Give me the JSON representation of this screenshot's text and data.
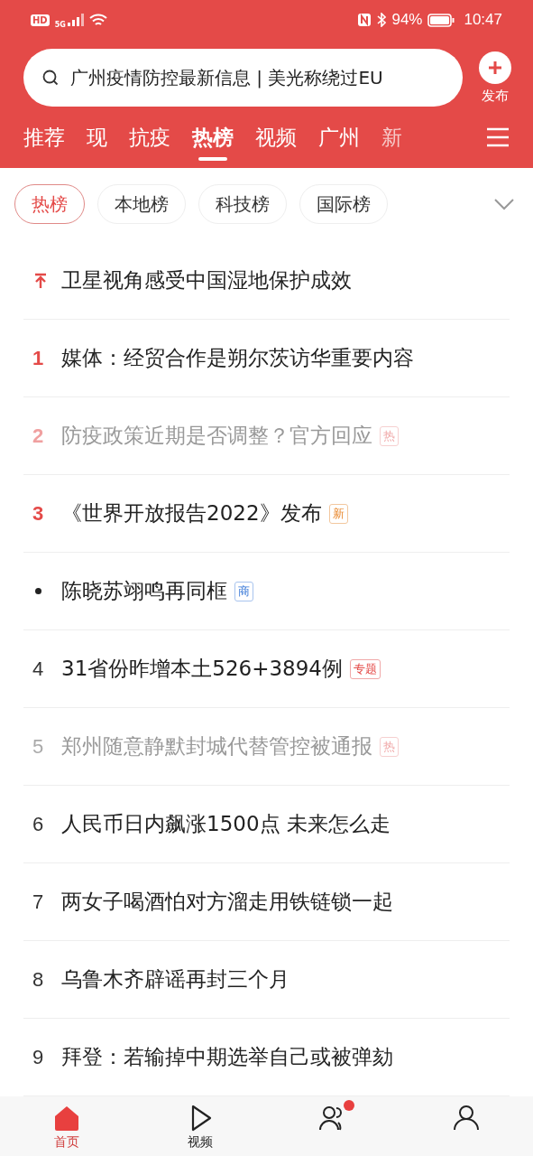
{
  "status_bar": {
    "hd": "HD",
    "network": "5G",
    "battery": "94%",
    "time": "10:47"
  },
  "search": {
    "value": "广州疫情防控最新信息 | 美光称绕过EU"
  },
  "publish": {
    "label": "发布"
  },
  "tabs": [
    {
      "label": "推荐",
      "selected": false
    },
    {
      "label": "现",
      "selected": false
    },
    {
      "label": "抗疫",
      "selected": false
    },
    {
      "label": "热榜",
      "selected": true
    },
    {
      "label": "视频",
      "selected": false
    },
    {
      "label": "广州",
      "selected": false
    },
    {
      "label": "新",
      "selected": false
    }
  ],
  "chips": [
    {
      "label": "热榜",
      "selected": true
    },
    {
      "label": "本地榜",
      "selected": false
    },
    {
      "label": "科技榜",
      "selected": false
    },
    {
      "label": "国际榜",
      "selected": false
    }
  ],
  "rows": [
    {
      "kind": "pinned",
      "title": "卫星视角感受中国湿地保护成效",
      "read": false
    },
    {
      "kind": "top",
      "rank": "1",
      "title": "媒体：经贸合作是朔尔茨访华重要内容",
      "read": false
    },
    {
      "kind": "top",
      "rank": "2",
      "title": "防疫政策近期是否调整？官方回应",
      "read": true,
      "badge": {
        "text": "热",
        "kind": "hot"
      }
    },
    {
      "kind": "top",
      "rank": "3",
      "title": "《世界开放报告2022》发布",
      "read": false,
      "badge": {
        "text": "新",
        "kind": "new"
      }
    },
    {
      "kind": "dot",
      "title": "陈晓苏翊鸣再同框",
      "read": false,
      "badge": {
        "text": "商",
        "kind": "ad"
      }
    },
    {
      "kind": "plain",
      "rank": "4",
      "title": "31省份昨增本土526+3894例",
      "read": false,
      "badge": {
        "text": "专题",
        "kind": "topic"
      }
    },
    {
      "kind": "plain",
      "rank": "5",
      "title": "郑州随意静默封城代替管控被通报",
      "read": true,
      "badge": {
        "text": "热",
        "kind": "hot"
      }
    },
    {
      "kind": "plain",
      "rank": "6",
      "title": "人民币日内飙涨1500点 未来怎么走",
      "read": false
    },
    {
      "kind": "plain",
      "rank": "7",
      "title": "两女子喝酒怕对方溜走用铁链锁一起",
      "read": false
    },
    {
      "kind": "plain",
      "rank": "8",
      "title": "乌鲁木齐辟谣再封三个月",
      "read": false
    },
    {
      "kind": "plain",
      "rank": "9",
      "title": "拜登：若输掉中期选举自己或被弹劾",
      "read": false
    }
  ],
  "bottom_nav": [
    {
      "kind": "home",
      "label": "首页",
      "selected": true
    },
    {
      "kind": "play",
      "label": "视频",
      "selected": false
    },
    {
      "kind": "people",
      "selected": false,
      "dot": true
    },
    {
      "kind": "person",
      "selected": false
    }
  ]
}
